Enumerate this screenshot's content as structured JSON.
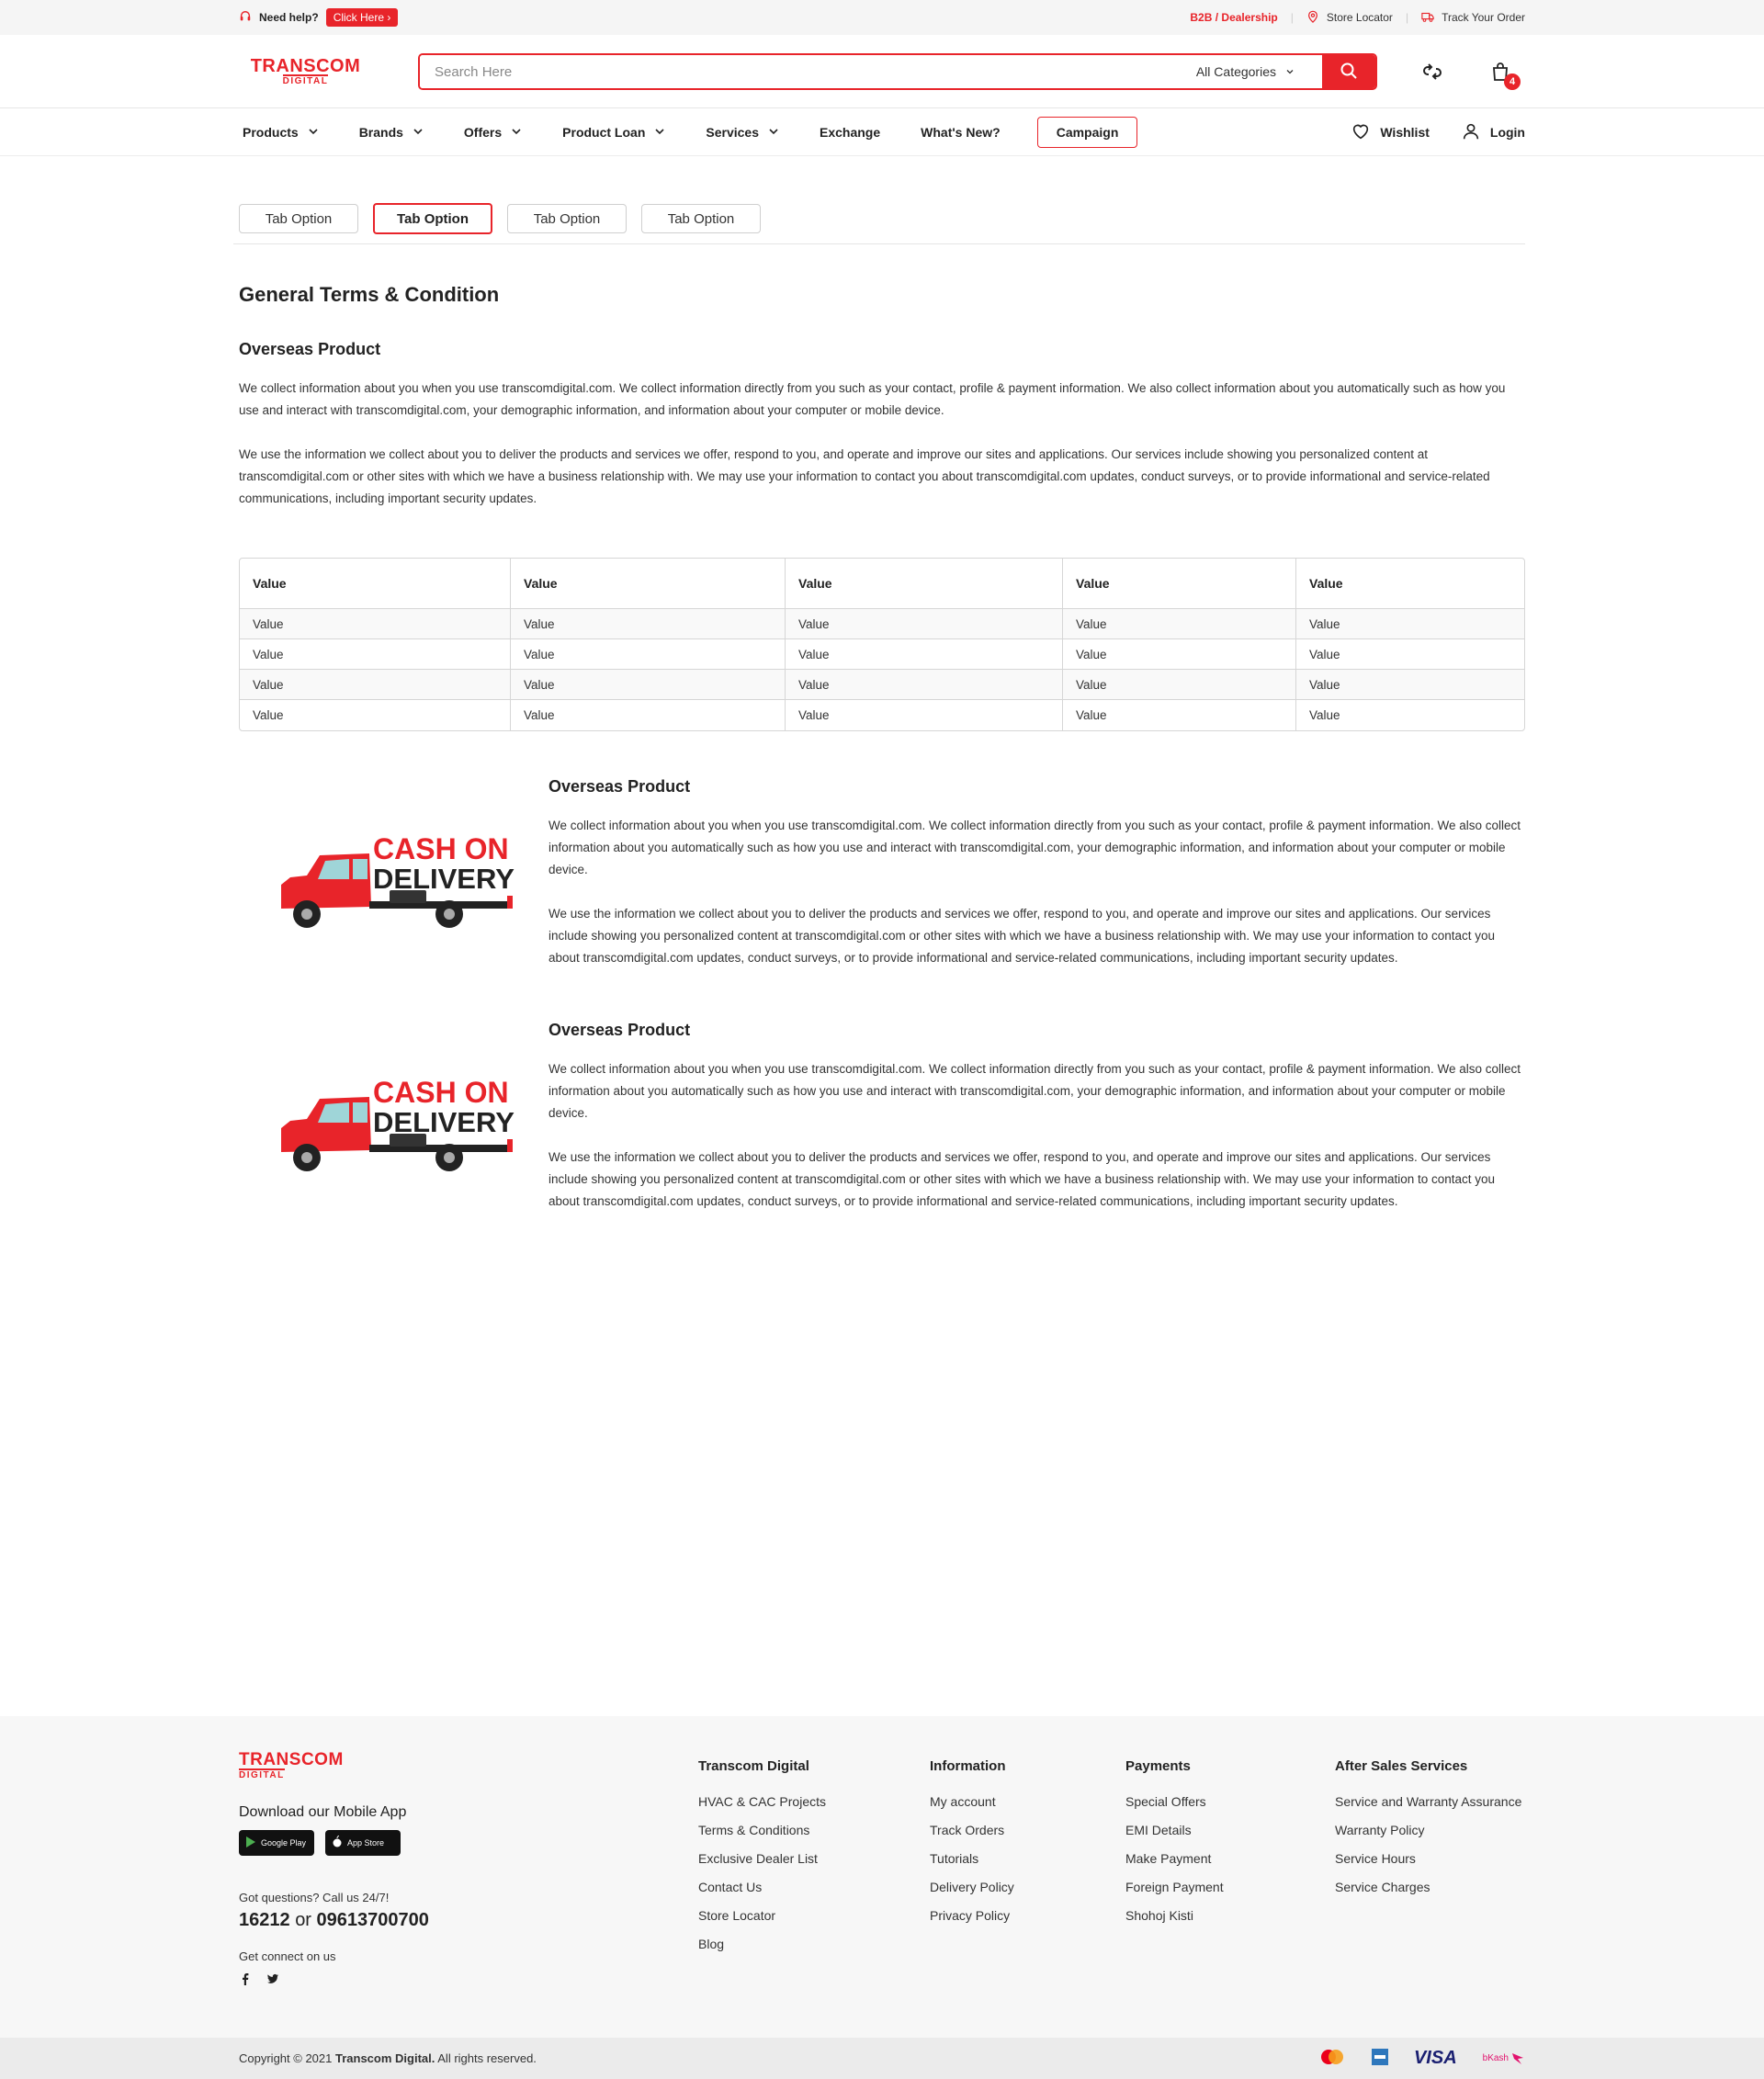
{
  "topbar": {
    "help_label": "Need help?",
    "click_here": "Click Here",
    "b2b": "B2B / Dealership",
    "store_locator": "Store Locator",
    "track_order": "Track Your Order"
  },
  "header": {
    "logo_top": "TRANSCOM",
    "logo_bottom": "DIGITAL",
    "search_placeholder": "Search Here",
    "category": "All Categories",
    "cart_count": "4"
  },
  "nav": {
    "items": [
      "Products",
      "Brands",
      "Offers",
      "Product Loan",
      "Services",
      "Exchange",
      "What's New?"
    ],
    "campaign": "Campaign",
    "wishlist": "Wishlist",
    "login": "Login"
  },
  "tabs": [
    "Tab Option",
    "Tab Option",
    "Tab Option",
    "Tab Option"
  ],
  "content": {
    "title": "General Terms & Condition",
    "section_title": "Overseas Product",
    "p1": "We collect information about you when you use transcomdigital.com. We collect information directly from you such as your contact, profile & payment information. We also collect information about you automatically such as how you use and interact with transcomdigital.com, your demographic information, and information about your computer or mobile device.",
    "p2": "We use the information we collect about you to deliver the products and services we offer, respond to you, and operate and improve our sites and applications. Our services include showing you personalized content at transcomdigital.com or other sites with which we have a business relationship with. We may use your information to contact you about transcomdigital.com updates, conduct surveys, or to provide informational and service-related communications, including important security updates."
  },
  "table": {
    "headers": [
      "Value",
      "Value",
      "Value",
      "Value",
      "Value"
    ],
    "rows": [
      [
        "Value",
        "Value",
        "Value",
        "Value",
        "Value"
      ],
      [
        "Value",
        "Value",
        "Value",
        "Value",
        "Value"
      ],
      [
        "Value",
        "Value",
        "Value",
        "Value",
        "Value"
      ],
      [
        "Value",
        "Value",
        "Value",
        "Value",
        "Value"
      ]
    ]
  },
  "features": [
    {
      "badge_line1": "CASH ON",
      "badge_line2": "DELIVERY",
      "title": "Overseas Product",
      "p1": "We collect information about you when you use transcomdigital.com. We collect information directly from you such as your contact, profile & payment information. We also collect information about you automatically such as how you use and interact with transcomdigital.com, your demographic information, and information about your computer or mobile device.",
      "p2": "We use the information we collect about you to deliver the products and services we offer, respond to you, and operate and improve our sites and applications. Our services include showing you personalized content at transcomdigital.com or other sites with which we have a business relationship with. We may use your information to contact you about transcomdigital.com updates, conduct surveys, or to provide informational and service-related communications, including important security updates."
    },
    {
      "badge_line1": "CASH ON",
      "badge_line2": "DELIVERY",
      "title": "Overseas Product",
      "p1": "We collect information about you when you use transcomdigital.com. We collect information directly from you such as your contact, profile & payment information. We also collect information about you automatically such as how you use and interact with transcomdigital.com, your demographic information, and information about your computer or mobile device.",
      "p2": "We use the information we collect about you to deliver the products and services we offer, respond to you, and operate and improve our sites and applications. Our services include showing you personalized content at transcomdigital.com or other sites with which we have a business relationship with. We may use your information to contact you about transcomdigital.com updates, conduct surveys, or to provide informational and service-related communications, including important security updates."
    }
  ],
  "footer": {
    "download_app": "Download our Mobile App",
    "google_play": "Google Play",
    "app_store": "App Store",
    "questions": "Got questions? Call us 24/7!",
    "phone1": "16212",
    "phone_or": "or",
    "phone2": "09613700700",
    "connect": "Get connect on us",
    "columns": [
      {
        "title": "Transcom Digital",
        "links": [
          "HVAC & CAC Projects",
          "Terms & Conditions",
          "Exclusive Dealer List",
          "Contact Us",
          "Store Locator",
          "Blog"
        ]
      },
      {
        "title": "Information",
        "links": [
          "My account",
          "Track Orders",
          "Tutorials",
          "Delivery Policy",
          "Privacy Policy"
        ]
      },
      {
        "title": "Payments",
        "links": [
          "Special Offers",
          "EMI Details",
          "Make Payment",
          "Foreign Payment",
          "Shohoj Kisti"
        ]
      },
      {
        "title": "After Sales Services",
        "links": [
          "Service and Warranty Assurance",
          "Warranty Policy",
          "Service Hours",
          "Service Charges"
        ]
      }
    ],
    "copyright_prefix": "Copyright © 2021",
    "copyright_brand": "Transcom Digital.",
    "copyright_suffix": "All rights reserved.",
    "payment_visa": "VISA",
    "payment_bkash": "bKash"
  },
  "colors": {
    "brand": "#e8242a",
    "footer_bg": "#f7f7f7"
  }
}
